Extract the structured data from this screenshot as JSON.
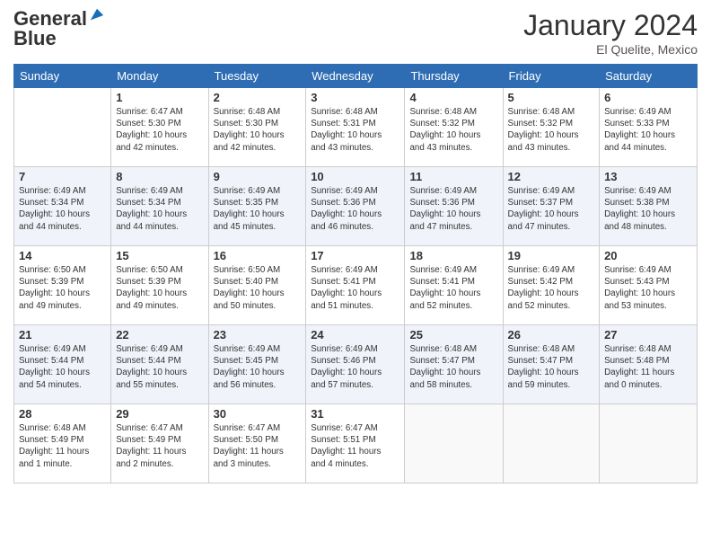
{
  "logo": {
    "line1": "General",
    "line2": "Blue"
  },
  "title": "January 2024",
  "location": "El Quelite, Mexico",
  "days_header": [
    "Sunday",
    "Monday",
    "Tuesday",
    "Wednesday",
    "Thursday",
    "Friday",
    "Saturday"
  ],
  "weeks": [
    [
      {
        "day": "",
        "info": ""
      },
      {
        "day": "1",
        "info": "Sunrise: 6:47 AM\nSunset: 5:30 PM\nDaylight: 10 hours\nand 42 minutes."
      },
      {
        "day": "2",
        "info": "Sunrise: 6:48 AM\nSunset: 5:30 PM\nDaylight: 10 hours\nand 42 minutes."
      },
      {
        "day": "3",
        "info": "Sunrise: 6:48 AM\nSunset: 5:31 PM\nDaylight: 10 hours\nand 43 minutes."
      },
      {
        "day": "4",
        "info": "Sunrise: 6:48 AM\nSunset: 5:32 PM\nDaylight: 10 hours\nand 43 minutes."
      },
      {
        "day": "5",
        "info": "Sunrise: 6:48 AM\nSunset: 5:32 PM\nDaylight: 10 hours\nand 43 minutes."
      },
      {
        "day": "6",
        "info": "Sunrise: 6:49 AM\nSunset: 5:33 PM\nDaylight: 10 hours\nand 44 minutes."
      }
    ],
    [
      {
        "day": "7",
        "info": ""
      },
      {
        "day": "8",
        "info": "Sunrise: 6:49 AM\nSunset: 5:34 PM\nDaylight: 10 hours\nand 44 minutes."
      },
      {
        "day": "9",
        "info": "Sunrise: 6:49 AM\nSunset: 5:35 PM\nDaylight: 10 hours\nand 45 minutes."
      },
      {
        "day": "10",
        "info": "Sunrise: 6:49 AM\nSunset: 5:36 PM\nDaylight: 10 hours\nand 46 minutes."
      },
      {
        "day": "11",
        "info": "Sunrise: 6:49 AM\nSunset: 5:36 PM\nDaylight: 10 hours\nand 47 minutes."
      },
      {
        "day": "12",
        "info": "Sunrise: 6:49 AM\nSunset: 5:37 PM\nDaylight: 10 hours\nand 47 minutes."
      },
      {
        "day": "13",
        "info": "Sunrise: 6:49 AM\nSunset: 5:38 PM\nDaylight: 10 hours\nand 48 minutes."
      }
    ],
    [
      {
        "day": "14",
        "info": ""
      },
      {
        "day": "15",
        "info": "Sunrise: 6:50 AM\nSunset: 5:39 PM\nDaylight: 10 hours\nand 49 minutes."
      },
      {
        "day": "16",
        "info": "Sunrise: 6:50 AM\nSunset: 5:40 PM\nDaylight: 10 hours\nand 50 minutes."
      },
      {
        "day": "17",
        "info": "Sunrise: 6:49 AM\nSunset: 5:41 PM\nDaylight: 10 hours\nand 51 minutes."
      },
      {
        "day": "18",
        "info": "Sunrise: 6:49 AM\nSunset: 5:41 PM\nDaylight: 10 hours\nand 52 minutes."
      },
      {
        "day": "19",
        "info": "Sunrise: 6:49 AM\nSunset: 5:42 PM\nDaylight: 10 hours\nand 52 minutes."
      },
      {
        "day": "20",
        "info": "Sunrise: 6:49 AM\nSunset: 5:43 PM\nDaylight: 10 hours\nand 53 minutes."
      }
    ],
    [
      {
        "day": "21",
        "info": ""
      },
      {
        "day": "22",
        "info": "Sunrise: 6:49 AM\nSunset: 5:44 PM\nDaylight: 10 hours\nand 55 minutes."
      },
      {
        "day": "23",
        "info": "Sunrise: 6:49 AM\nSunset: 5:45 PM\nDaylight: 10 hours\nand 56 minutes."
      },
      {
        "day": "24",
        "info": "Sunrise: 6:49 AM\nSunset: 5:46 PM\nDaylight: 10 hours\nand 57 minutes."
      },
      {
        "day": "25",
        "info": "Sunrise: 6:48 AM\nSunset: 5:47 PM\nDaylight: 10 hours\nand 58 minutes."
      },
      {
        "day": "26",
        "info": "Sunrise: 6:48 AM\nSunset: 5:47 PM\nDaylight: 10 hours\nand 59 minutes."
      },
      {
        "day": "27",
        "info": "Sunrise: 6:48 AM\nSunset: 5:48 PM\nDaylight: 11 hours\nand 0 minutes."
      }
    ],
    [
      {
        "day": "28",
        "info": ""
      },
      {
        "day": "29",
        "info": "Sunrise: 6:47 AM\nSunset: 5:49 PM\nDaylight: 11 hours\nand 2 minutes."
      },
      {
        "day": "30",
        "info": "Sunrise: 6:47 AM\nSunset: 5:50 PM\nDaylight: 11 hours\nand 3 minutes."
      },
      {
        "day": "31",
        "info": "Sunrise: 6:47 AM\nSunset: 5:51 PM\nDaylight: 11 hours\nand 4 minutes."
      },
      {
        "day": "",
        "info": ""
      },
      {
        "day": "",
        "info": ""
      },
      {
        "day": "",
        "info": ""
      }
    ]
  ],
  "week1_sun_info": "Sunrise: 6:49 AM\nSunset: 5:34 PM\nDaylight: 10 hours\nand 44 minutes.",
  "week3_sun_info": "Sunrise: 6:50 AM\nSunset: 5:39 PM\nDaylight: 10 hours\nand 49 minutes.",
  "week4_sun_info": "Sunrise: 6:49 AM\nSunset: 5:44 PM\nDaylight: 10 hours\nand 54 minutes.",
  "week5_sun_info": "Sunrise: 6:48 AM\nSunset: 5:49 PM\nDaylight: 11 hours\nand 1 minute."
}
